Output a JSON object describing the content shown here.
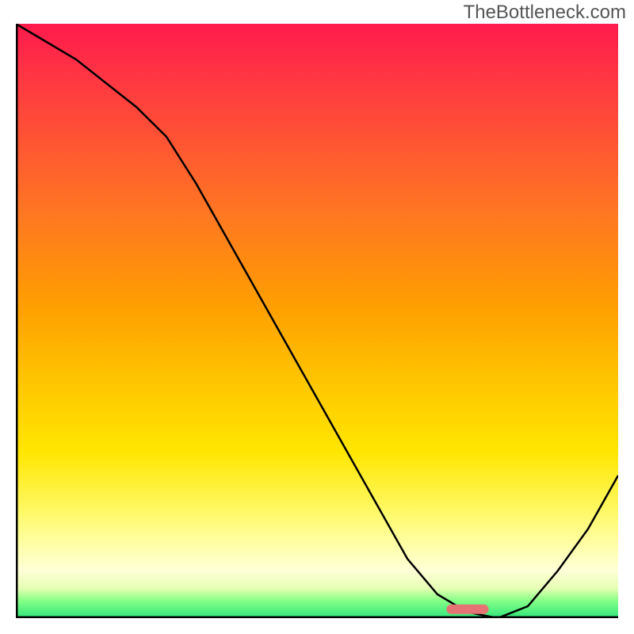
{
  "watermark": "TheBottleneck.com",
  "chart_data": {
    "type": "line",
    "title": "",
    "xlabel": "",
    "ylabel": "",
    "x": [
      0,
      5,
      10,
      15,
      20,
      25,
      30,
      35,
      40,
      45,
      50,
      55,
      60,
      65,
      70,
      75,
      80,
      85,
      90,
      95,
      100
    ],
    "values": [
      100,
      97,
      94,
      90,
      86,
      81,
      73,
      64,
      55,
      46,
      37,
      28,
      19,
      10,
      4,
      1,
      0,
      2,
      8,
      15,
      24
    ],
    "xlim": [
      0,
      100
    ],
    "ylim": [
      0,
      100
    ],
    "marker": {
      "x": 75,
      "y": 1.5,
      "width": 7
    },
    "gradient_stops": [
      {
        "pos": 0,
        "color": "#ff1a4d"
      },
      {
        "pos": 50,
        "color": "#ffc500"
      },
      {
        "pos": 90,
        "color": "#ffffcc"
      },
      {
        "pos": 100,
        "color": "#2fe67a"
      }
    ]
  }
}
